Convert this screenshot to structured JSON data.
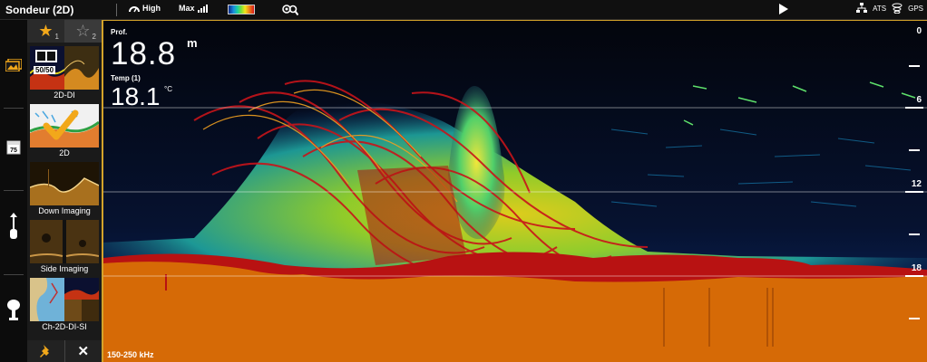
{
  "topbar": {
    "title": "Sondeur (2D)",
    "high_label": "High",
    "max_label": "Max",
    "right_labels": [
      "ATS",
      "GPS"
    ]
  },
  "favorites": {
    "tab1_number": "1",
    "tab2_number": "2",
    "items": [
      {
        "label": "2D-DI",
        "badge": "50/50"
      },
      {
        "label": "2D"
      },
      {
        "label": "Down Imaging"
      },
      {
        "label": "Side Imaging"
      },
      {
        "label": "Ch-2D-DI-SI"
      }
    ]
  },
  "sidebar": {
    "temp_badge": "75"
  },
  "readouts": {
    "depth_label": "Prof.",
    "depth_value": "18.8",
    "depth_unit": "m",
    "temp_label": "Temp (1)",
    "temp_value": "18.1",
    "temp_unit": "°C"
  },
  "depth_scale": {
    "top": "0",
    "marks": [
      "6",
      "12",
      "18"
    ]
  },
  "frequency": "150-250 kHz",
  "colors": {
    "accent": "#d4a32a",
    "bottom": "#d66a06",
    "seabed_edge": "#b31212"
  }
}
